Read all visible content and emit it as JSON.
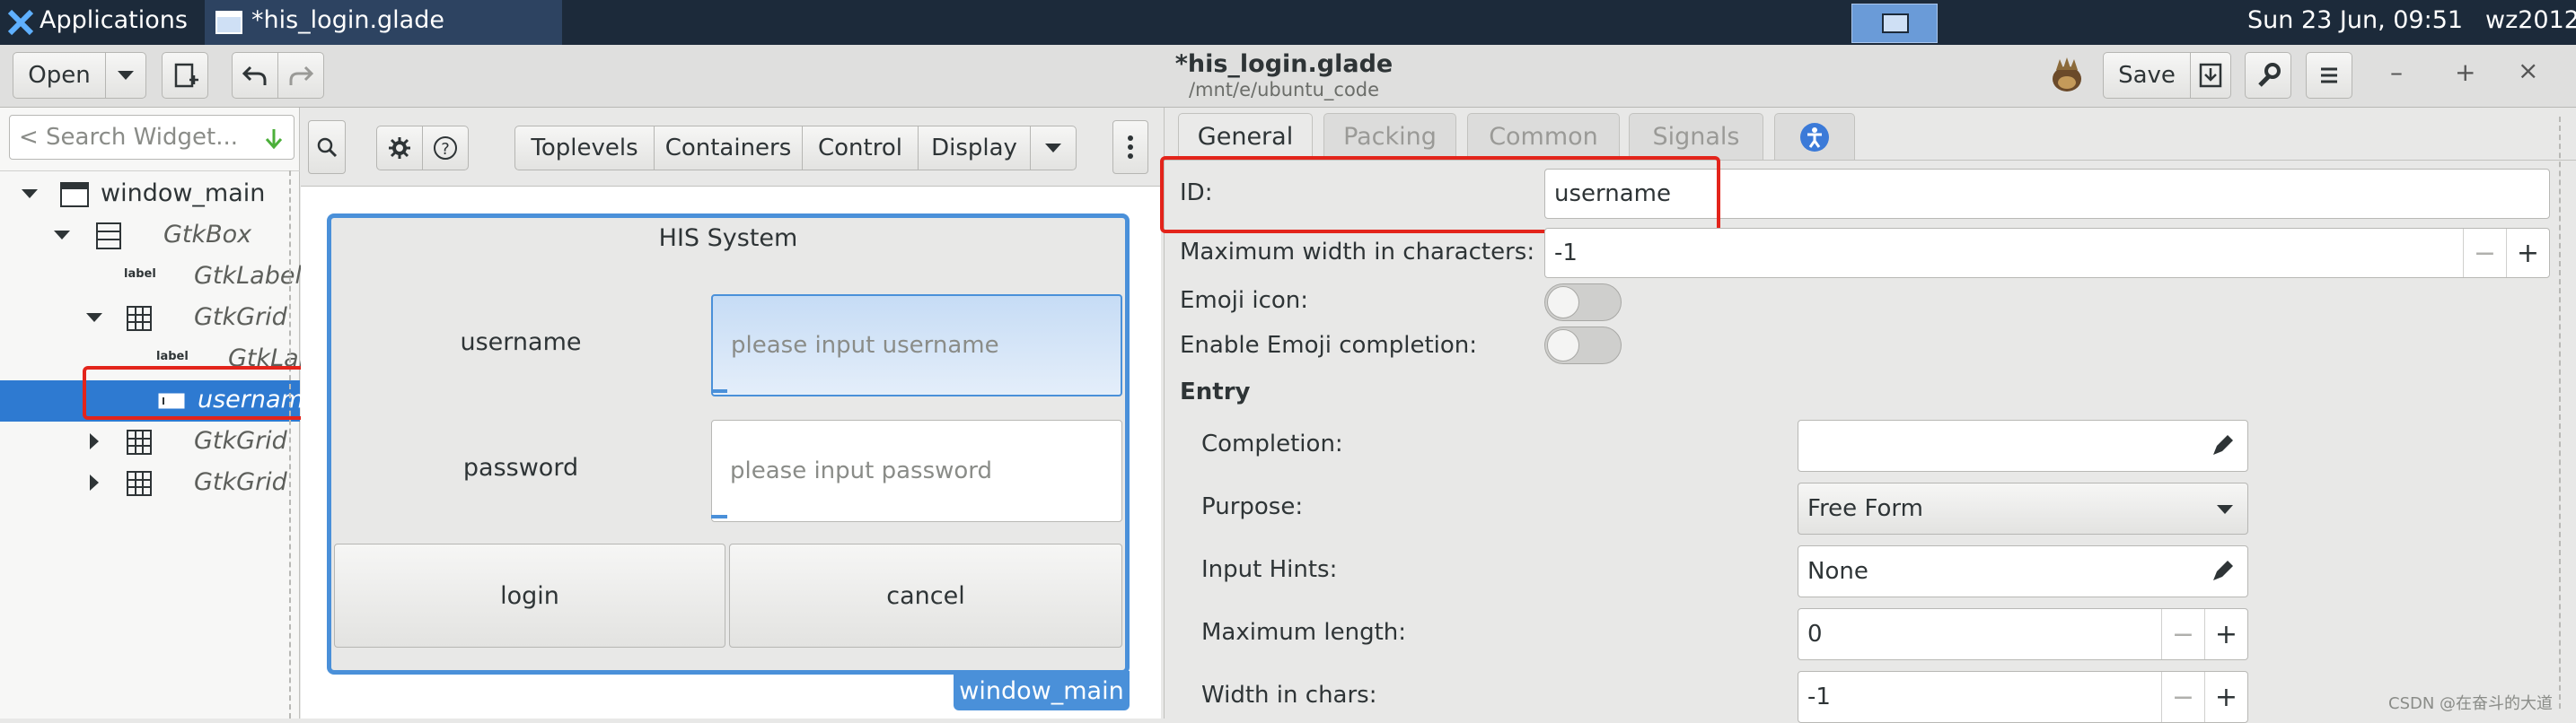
{
  "panel": {
    "applications": "Applications",
    "window_title": "*his_login.glade",
    "clock": "Sun 23 Jun, 09:51",
    "user": "wz2012"
  },
  "header": {
    "open_label": "Open",
    "title": "*his_login.glade",
    "subtitle": "/mnt/e/ubuntu_code",
    "save_label": "Save"
  },
  "palette": {
    "search_placeholder": "< Search Widget..."
  },
  "tree": [
    {
      "label": "window_main"
    },
    {
      "label": "GtkBox"
    },
    {
      "label": "GtkLabel"
    },
    {
      "label": "GtkGrid"
    },
    {
      "label": "GtkLabel"
    },
    {
      "label": "username"
    },
    {
      "label": "GtkGrid"
    },
    {
      "label": "GtkGrid"
    }
  ],
  "tree_icon_text": "label",
  "toolbar": {
    "toplevels": "Toplevels",
    "containers": "Containers",
    "control": "Control",
    "display": "Display"
  },
  "canvas": {
    "title": "HIS System",
    "username_label": "username",
    "username_placeholder": "please input username",
    "password_label": "password",
    "password_placeholder": "please input password",
    "login": "login",
    "cancel": "cancel",
    "window_tag": "window_main"
  },
  "tabs": {
    "general": "General",
    "packing": "Packing",
    "common": "Common",
    "signals": "Signals"
  },
  "props": {
    "id_label": "ID:",
    "id_value": "username",
    "max_width_label": "Maximum width in characters:",
    "max_width_value": "-1",
    "emoji_icon_label": "Emoji icon:",
    "emoji_completion_label": "Enable Emoji completion:",
    "entry_header": "Entry",
    "completion_label": "Completion:",
    "completion_value": "",
    "purpose_label": "Purpose:",
    "purpose_value": "Free Form",
    "input_hints_label": "Input Hints:",
    "input_hints_value": "None",
    "max_length_label": "Maximum length:",
    "max_length_value": "0",
    "width_chars_label": "Width in chars:",
    "width_chars_value": "-1",
    "minus": "−",
    "plus": "+"
  },
  "watermark": "CSDN @在奋斗的大道",
  "colors": {
    "accent": "#4a90d9",
    "selection": "#2e7ad1",
    "highlight": "#e3241b",
    "panel": "#1c2a3a"
  }
}
